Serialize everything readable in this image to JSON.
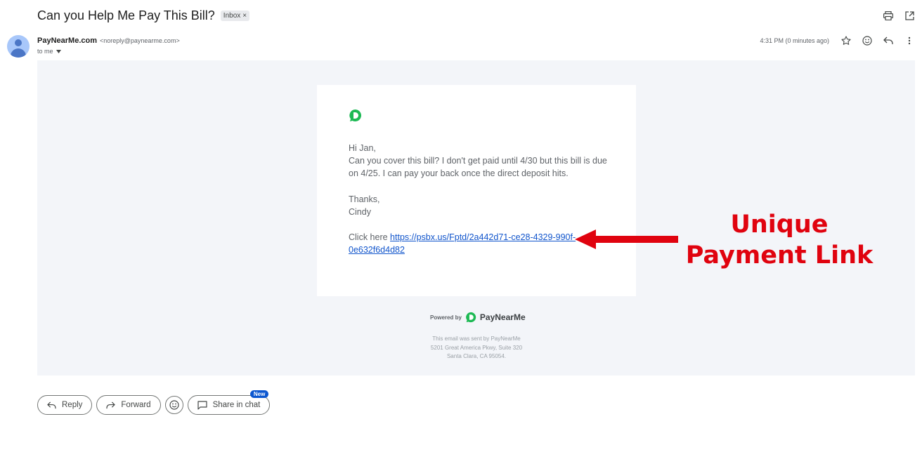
{
  "header": {
    "subject": "Can you Help Me Pay This Bill?",
    "label_chip": "Inbox",
    "label_chip_close": "×",
    "icons": [
      "print-icon",
      "open-in-new-window-icon"
    ]
  },
  "sender": {
    "name": "PayNearMe.com",
    "email": "<noreply@paynearme.com>",
    "to": "to me",
    "timestamp": "4:31 PM (0 minutes ago)",
    "icons": [
      "star-icon",
      "emoji-icon",
      "reply-icon",
      "more-vert-icon"
    ]
  },
  "email": {
    "brand_color": "#1db954",
    "greeting": "Hi Jan,",
    "body_line1": "Can you cover this bill? I don't get paid until 4/30 but this bill is due",
    "body_line2": "on 4/25. I can pay your back once the direct deposit hits.",
    "signoff": "Thanks,",
    "signature": "Cindy",
    "click_prefix": "Click here ",
    "link_part1": "https://psbx.us/Fptd/2a442d71-ce28-4329-990f-",
    "link_part2": "0e632f6d4d82"
  },
  "footer": {
    "powered_by": "Powered by",
    "brand": "PayNearMe",
    "line1": "This email was sent by PayNearMe",
    "line2": "5201 Great America Pkwy, Suite 320",
    "line3": "Santa Clara, CA 95054."
  },
  "annotation": {
    "line1": "Unique",
    "line2": "Payment Link",
    "color": "#e0030f"
  },
  "actions": {
    "reply": "Reply",
    "forward": "Forward",
    "share": "Share in chat",
    "new_badge": "New"
  }
}
